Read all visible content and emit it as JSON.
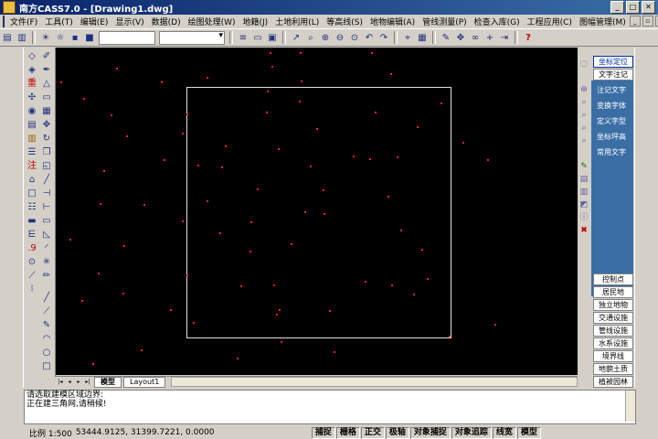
{
  "window": {
    "title": "南方CASS7.0 - [Drawing1.dwg]",
    "minimize": "_",
    "maximize": "□",
    "close": "✕"
  },
  "menu": [
    "文件(F)",
    "工具(T)",
    "编辑(E)",
    "显示(V)",
    "数据(D)",
    "绘图处理(W)",
    "地籍(J)",
    "土地利用(L)",
    "等高线(S)",
    "地物编辑(A)",
    "管线测量(P)",
    "检查入库(G)",
    "工程应用(C)",
    "图幅管理(M)"
  ],
  "tabs": {
    "model": "模型",
    "layout": "Layout1"
  },
  "right_panel": {
    "top": [
      "坐标定位",
      "文字注记"
    ],
    "blue": [
      "注记文字",
      "变换字体",
      "定义字型",
      "坐标坪高",
      "常用文字"
    ],
    "bottom": [
      "控制点",
      "居民地",
      "独立地物",
      "交通设施",
      "管线设施",
      "水系设施",
      "境界线",
      "地貌土质",
      "植被园林"
    ]
  },
  "command": {
    "line1": "请选取建模区域边界:",
    "line2": "正在建三角网,请稍候!"
  },
  "status": {
    "scale": "比例 1:500",
    "coords": "53444.9125, 31399.7221, 0.0000",
    "buttons": [
      "捕捉",
      "栅格",
      "正交",
      "极轴",
      "对象捕捉",
      "对象追踪",
      "线宽",
      "模型"
    ]
  },
  "colors": {
    "canvas": "#000000",
    "points": "#ff2020",
    "boundary": "#e0e0e0",
    "panel_blue": "#3a6ea5"
  }
}
